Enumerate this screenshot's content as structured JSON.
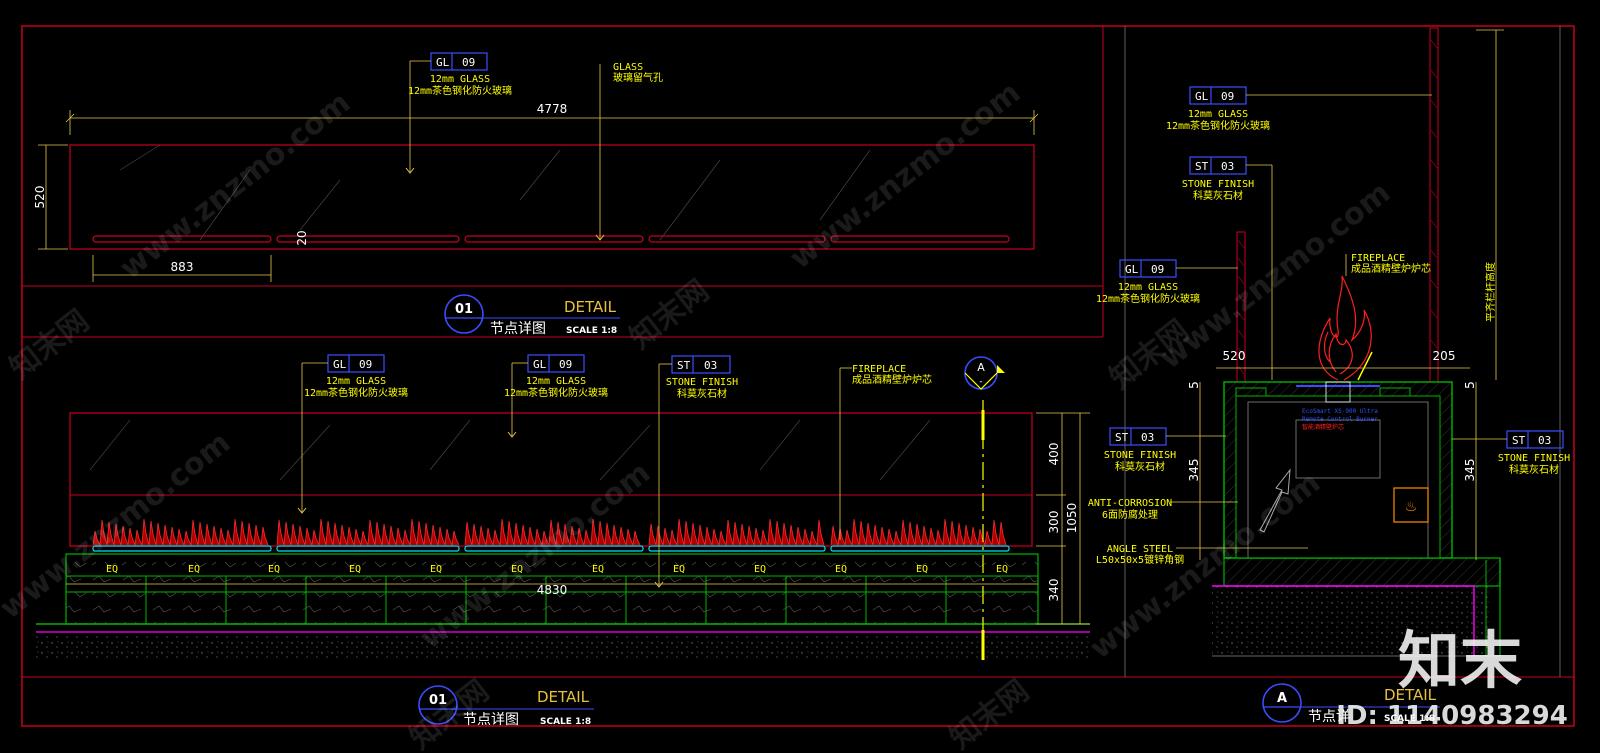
{
  "colors": {
    "background": "#000000",
    "frame": "#c8001e",
    "dimension": "#e6c84a",
    "text": "#ffff00",
    "tag_box": "#3a4cff",
    "stone": "#00b400",
    "flame": "#ff1e1e",
    "finish": "#ff00ff",
    "cyan": "#00e0ff"
  },
  "top_plan": {
    "tag": {
      "code": "GL",
      "num": "09"
    },
    "tag_line1": "12mm GLASS",
    "tag_line2": "12mm茶色钢化防火玻璃",
    "glass_note_line1": "GLASS",
    "glass_note_line2": "玻璃留气孔",
    "dim_width": "4778",
    "dim_height": "520",
    "dim_slot": "883",
    "dim_slot_h": "20",
    "title_num": "01",
    "title_en": "DETAIL",
    "title_cn": "节点详图",
    "title_scale": "SCALE 1:8"
  },
  "elevation": {
    "tag1": {
      "code": "GL",
      "num": "09",
      "line1": "12mm GLASS",
      "line2": "12mm茶色钢化防火玻璃"
    },
    "tag2": {
      "code": "GL",
      "num": "09",
      "line1": "12mm GLASS",
      "line2": "12mm茶色钢化防火玻璃"
    },
    "tag3": {
      "code": "ST",
      "num": "03",
      "line1": "STONE FINISH",
      "line2": "科莫灰石材"
    },
    "fireplace_line1": "FIREPLACE",
    "fireplace_line2": "成品酒精壁炉炉芯",
    "section_marker": {
      "letter": "A",
      "sub": "-"
    },
    "eq_labels": [
      "EQ",
      "EQ",
      "EQ",
      "EQ",
      "EQ",
      "EQ",
      "EQ",
      "EQ",
      "EQ",
      "EQ",
      "EQ",
      "EQ",
      "EQ",
      "EQ",
      "EQ"
    ],
    "dim_total": "4830",
    "dim_400": "400",
    "dim_300": "300",
    "dim_1050": "1050",
    "dim_340": "340",
    "title_num": "01",
    "title_en": "DETAIL",
    "title_cn": "节点详图",
    "title_scale": "SCALE 1:8"
  },
  "section": {
    "tag_gl_top": {
      "code": "GL",
      "num": "09",
      "line1": "12mm GLASS",
      "line2": "12mm茶色钢化防火玻璃"
    },
    "tag_st_top": {
      "code": "ST",
      "num": "03",
      "line1": "STONE FINISH",
      "line2": "科莫灰石材"
    },
    "tag_gl_mid": {
      "code": "GL",
      "num": "09",
      "line1": "12mm GLASS",
      "line2": "12mm茶色钢化防火玻璃"
    },
    "tag_st_left": {
      "code": "ST",
      "num": "03",
      "line1": "STONE FINISH",
      "line2": "科莫灰石材"
    },
    "tag_st_right": {
      "code": "ST",
      "num": "03",
      "line1": "STONE FINISH",
      "line2": "科莫灰石材"
    },
    "fireplace_line1": "FIREPLACE",
    "fireplace_line2": "成品酒精壁炉炉芯",
    "rail_note": "平齐栏杆高度",
    "dim_520": "520",
    "dim_205": "205",
    "dim_5_left": "5",
    "dim_5_right": "5",
    "dim_345_left": "345",
    "dim_345_right": "345",
    "anti_line1": "ANTI-CORROSION",
    "anti_line2": "6面防腐处理",
    "angle_line1": "ANGLE STEEL",
    "angle_line2": "L50x50x5镀锌角钢",
    "burner_blue1": "EcoSmart  XS-900 Ultra",
    "burner_blue2": "Remote Control Burner",
    "burner_red": "智能酒精壁炉芯",
    "title_letter": "A",
    "title_en": "DETAIL",
    "title_cn": "节点详",
    "title_scale": "SCALE 1:8"
  },
  "watermark": {
    "site": "www.znzmo.com",
    "cn": "知末网",
    "brand": "知末",
    "id": "ID: 1140983294"
  }
}
